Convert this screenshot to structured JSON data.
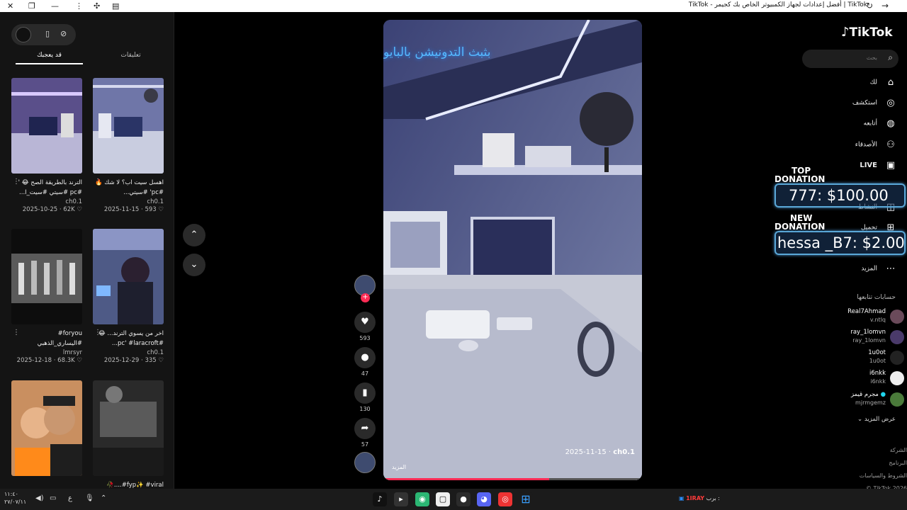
{
  "window": {
    "title": "TikTok | أفضل إعدادات لجهاز الكمبيوتر الخاص بك كجيمر - TikTok"
  },
  "left_panel": {
    "tabs": [
      {
        "label": "تعليقات",
        "active": false
      },
      {
        "label": "قد يعجبك",
        "active": true
      }
    ],
    "cards": [
      {
        "caption": "اهسل سيت اب؟ لا شك 🔥 #pc' #سيتي...",
        "author": "ch0.1",
        "date": "2025-11-15",
        "likes": "593"
      },
      {
        "caption": "الترند بالطريقة الصح 😂 ' #pc #سيتي #سيت_ا...",
        "author": "ch0.1",
        "date": "2025-10-25",
        "likes": "62K"
      },
      {
        "caption": "اخر من يسوي الترند... 😂 #pc' #laracroft...",
        "author": "ch0.1",
        "date": "2025-12-29",
        "likes": "335"
      },
      {
        "caption": "foryou# #اليساري_الذهبي #كشكول",
        "author": "lmrsyr",
        "date": "2025-12-18",
        "likes": "68.3K"
      },
      {
        "caption": "fyp✨ #viral#....🥀",
        "author": "",
        "date": "",
        "likes": ""
      },
      {
        "caption": "",
        "author": "",
        "date": "",
        "likes": ""
      }
    ]
  },
  "nav_buttons": {
    "up": "⌃",
    "down": "⌄"
  },
  "video": {
    "overlay_text": "بثبث التدونيشن بالبايو",
    "author": "ch0.1",
    "date": "2025-11-15",
    "more_label": "المزيد",
    "progress": 0.64
  },
  "actions": {
    "likes": "593",
    "comments": "47",
    "saves": "130",
    "shares": "57"
  },
  "sidebar": {
    "logo": "TikTok",
    "search_placeholder": "بحث",
    "items": [
      {
        "label": "لك",
        "icon": "home-icon"
      },
      {
        "label": "استكشف",
        "icon": "compass-icon"
      },
      {
        "label": "أتابعه",
        "icon": "following-avatar"
      },
      {
        "label": "الأصدقاء",
        "icon": "friends-icon"
      },
      {
        "label": "LIVE",
        "icon": "live-icon"
      },
      {
        "label": "النشاط",
        "icon": "activity-icon"
      },
      {
        "label": "تحميل",
        "icon": "upload-icon"
      },
      {
        "label": "المزيد",
        "icon": "more-icon"
      }
    ],
    "following_header": "حسابات تتابعها",
    "following": [
      {
        "name": "Real7Ahmad",
        "username": "v.ntlq"
      },
      {
        "name": "ray_1lomvn",
        "username": "ray_1lomvn"
      },
      {
        "name": "1u0ot",
        "username": "1u0ot"
      },
      {
        "name": "i6nkk",
        "username": "i6nkk"
      },
      {
        "name": "مجرم قيمز",
        "username": "mjrmgemz"
      }
    ],
    "show_more": "عرض المزيد",
    "footer_links": [
      "الشركة",
      "البرنامج",
      "الشروط والسياسات",
      "TikTok 2026 ©"
    ]
  },
  "donations": {
    "top_label_1": "TOP",
    "top_label_2": "DONATION",
    "top_value": "777: $100.00",
    "new_label_1": "NEW",
    "new_label_2": "DONATION",
    "new_value": "hessa _B7: $2.00"
  },
  "taskbar": {
    "time": "١١:٤٠",
    "date": "٢٧/٠٧/١١",
    "ticker_label": "برب :",
    "ticker_user": "1IRAY"
  }
}
